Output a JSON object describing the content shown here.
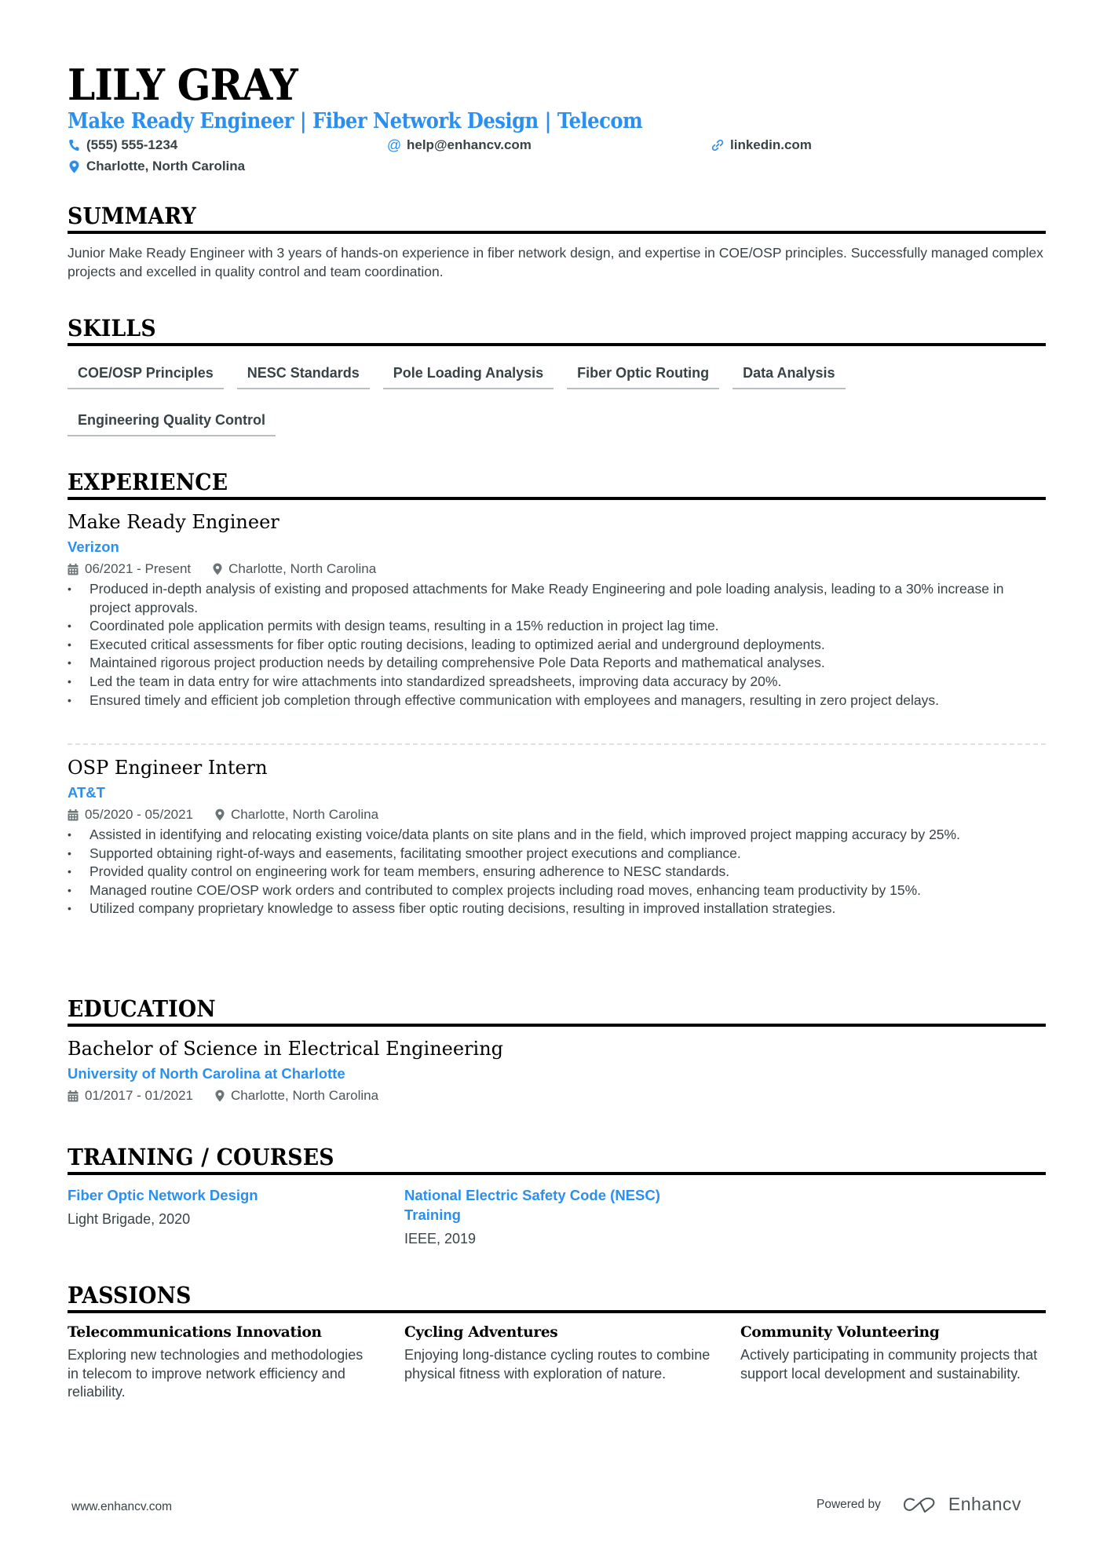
{
  "header": {
    "name": "LILY GRAY",
    "headline": "Make Ready Engineer | Fiber Network Design | Telecom",
    "contacts": {
      "phone": {
        "icon": "phone-icon",
        "value": "(555) 555-1234"
      },
      "email": {
        "icon": "at-icon",
        "value": "help@enhancv.com"
      },
      "linkedin": {
        "icon": "link-icon",
        "value": "linkedin.com"
      },
      "location": {
        "icon": "map-pin-icon",
        "value": "Charlotte, North Carolina"
      }
    }
  },
  "colors": {
    "accent": "#2b8fef",
    "text": "#384347",
    "heading": "#000000"
  },
  "summary": {
    "title": "SUMMARY",
    "text": "Junior Make Ready Engineer with 3 years of hands-on experience in fiber network design, and expertise in COE/OSP principles. Successfully managed complex projects and excelled in quality control and team coordination."
  },
  "skills": {
    "title": "SKILLS",
    "items": [
      "COE/OSP Principles",
      "NESC Standards",
      "Pole Loading Analysis",
      "Fiber Optic Routing",
      "Data Analysis",
      "Engineering Quality Control"
    ]
  },
  "experience": {
    "title": "EXPERIENCE",
    "items": [
      {
        "role": "Make Ready Engineer",
        "company": "Verizon",
        "dates": "06/2021 - Present",
        "location": "Charlotte, North Carolina",
        "bullets": [
          "Produced in-depth analysis of existing and proposed attachments for Make Ready Engineering and pole loading analysis, leading to a 30% increase in project approvals.",
          "Coordinated pole application permits with design teams, resulting in a 15% reduction in project lag time.",
          "Executed critical assessments for fiber optic routing decisions, leading to optimized aerial and underground deployments.",
          "Maintained rigorous project production needs by detailing comprehensive Pole Data Reports and mathematical analyses.",
          "Led the team in data entry for wire attachments into standardized spreadsheets, improving data accuracy by 20%.",
          "Ensured timely and efficient job completion through effective communication with employees and managers, resulting in zero project delays."
        ]
      },
      {
        "role": "OSP Engineer Intern",
        "company": "AT&T",
        "dates": "05/2020 - 05/2021",
        "location": "Charlotte, North Carolina",
        "bullets": [
          "Assisted in identifying and relocating existing voice/data plants on site plans and in the field, which improved project mapping accuracy by 25%.",
          "Supported obtaining right-of-ways and easements, facilitating smoother project executions and compliance.",
          "Provided quality control on engineering work for team members, ensuring adherence to NESC standards.",
          "Managed routine COE/OSP work orders and contributed to complex projects including road moves, enhancing team productivity by 15%.",
          "Utilized company proprietary knowledge to assess fiber optic routing decisions, resulting in improved installation strategies."
        ]
      }
    ]
  },
  "education": {
    "title": "EDUCATION",
    "items": [
      {
        "degree": "Bachelor of Science in Electrical Engineering",
        "school": "University of North Carolina at Charlotte",
        "dates": "01/2017 - 01/2021",
        "location": "Charlotte, North Carolina"
      }
    ]
  },
  "training": {
    "title": "TRAINING / COURSES",
    "items": [
      {
        "title": "Fiber Optic Network Design",
        "provider": "Light Brigade, 2020"
      },
      {
        "title": "National Electric Safety Code (NESC) Training",
        "provider": "IEEE, 2019"
      }
    ]
  },
  "passions": {
    "title": "PASSIONS",
    "items": [
      {
        "title": "Telecommunications Innovation",
        "description": "Exploring new technologies and methodologies in telecom to improve network efficiency and reliability."
      },
      {
        "title": "Cycling Adventures",
        "description": "Enjoying long-distance cycling routes to combine physical fitness with exploration of nature."
      },
      {
        "title": "Community Volunteering",
        "description": "Actively participating in community projects that support local development and sustainability."
      }
    ]
  },
  "footer": {
    "website": "www.enhancv.com",
    "powered_by": "Powered by",
    "brand": "Enhancv",
    "brand_icon": "enhancv-logo-icon"
  }
}
